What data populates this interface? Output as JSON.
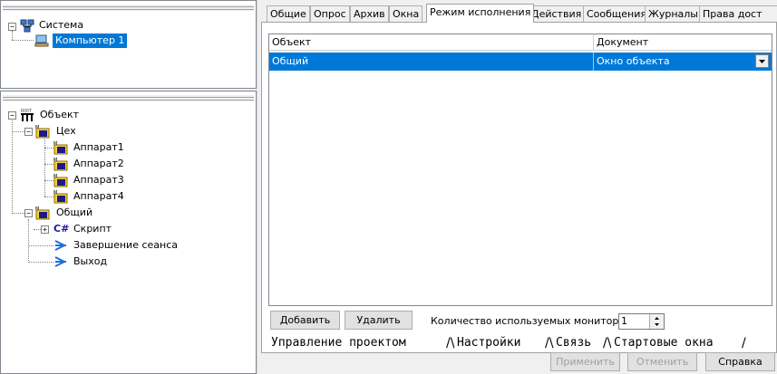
{
  "system_tree": {
    "root": {
      "label": "Система",
      "icon": "network-icon"
    },
    "children": [
      {
        "label": "Компьютер 1",
        "icon": "computer-icon",
        "selected": true
      }
    ]
  },
  "object_tree": {
    "root": {
      "label": "Объект",
      "icon": "object-icon"
    },
    "ceh": {
      "label": "Цех",
      "icon": "module-folder-icon",
      "children": [
        {
          "label": "Аппарат1"
        },
        {
          "label": "Аппарат2"
        },
        {
          "label": "Аппарат3"
        },
        {
          "label": "Аппарат4"
        }
      ]
    },
    "common": {
      "label": "Общий",
      "icon": "module-folder-icon"
    },
    "script": {
      "prefix": "C#",
      "label": "Скрипт"
    },
    "end_session": {
      "label": "Завершение сеанса",
      "icon": "arrow-icon"
    },
    "exit": {
      "label": "Выход",
      "icon": "arrow-icon"
    }
  },
  "tabs": [
    "Общие",
    "Опрос",
    "Архив",
    "Окна",
    "Режим исполнения",
    "Действия",
    "Сообщения",
    "Журналы",
    "Права дост"
  ],
  "active_tab": "Режим исполнения",
  "grid": {
    "columns": [
      "Объект",
      "Документ"
    ],
    "rows": [
      {
        "object": "Общий",
        "document": "Окно объекта",
        "selected": true
      }
    ]
  },
  "controls": {
    "add_label": "Добавить",
    "delete_label": "Удалить",
    "monitors_label": "Количество используемых мониторов :",
    "monitors_value": "1"
  },
  "bottom_tabs": [
    "Управление проектом",
    "Настройки",
    "Связь",
    "Стартовые окна"
  ],
  "active_bottom_tab": "Стартовые окна",
  "dialog_buttons": {
    "apply": "Применить",
    "cancel": "Отменить",
    "help": "Справка"
  },
  "colors": {
    "selection": "#0078d7",
    "panel": "#f0f0f0"
  }
}
